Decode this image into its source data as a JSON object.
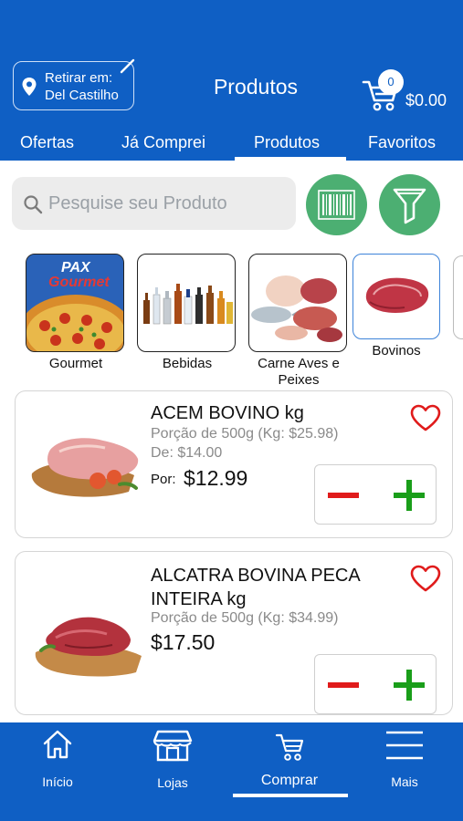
{
  "header": {
    "store_label": "Retirar em:",
    "store_name": "Del Castilho",
    "title": "Produtos",
    "cart_count": "0",
    "cart_total": "$0.00"
  },
  "tabs": [
    {
      "label": "Ofertas"
    },
    {
      "label": "Já Comprei"
    },
    {
      "label": "Produtos",
      "active": true
    },
    {
      "label": "Favoritos"
    }
  ],
  "search": {
    "placeholder": "Pesquise seu Produto"
  },
  "categories": [
    {
      "name": "Gourmet",
      "logo_text_1": "PAX",
      "logo_text_2": "Gourmet"
    },
    {
      "name": "Bebidas"
    },
    {
      "name": "Carne Aves e Peixes"
    },
    {
      "name": "Bovinos",
      "selected": true
    }
  ],
  "products": [
    {
      "name": "ACEM BOVINO kg",
      "portion": "Porção de 500g (Kg: $25.98)",
      "old_price": "De: $14.00",
      "price_label": "Por:",
      "price": "$12.99"
    },
    {
      "name_line1": "ALCATRA BOVINA PECA",
      "name_line2": "INTEIRA kg",
      "portion": "Porção de 500g (Kg: $34.99)",
      "price": "$17.50"
    }
  ],
  "bottom_nav": [
    {
      "label": "Início",
      "icon": "home-icon"
    },
    {
      "label": "Lojas",
      "icon": "store-icon"
    },
    {
      "label": "Comprar",
      "icon": "cart-icon",
      "active": true
    },
    {
      "label": "Mais",
      "icon": "menu-icon"
    }
  ],
  "colors": {
    "brand": "#0f5fc4",
    "action_green": "#4caf72",
    "minus_red": "#e01b1b",
    "plus_green": "#1a9e1a",
    "heart_red": "#e01b1b"
  }
}
